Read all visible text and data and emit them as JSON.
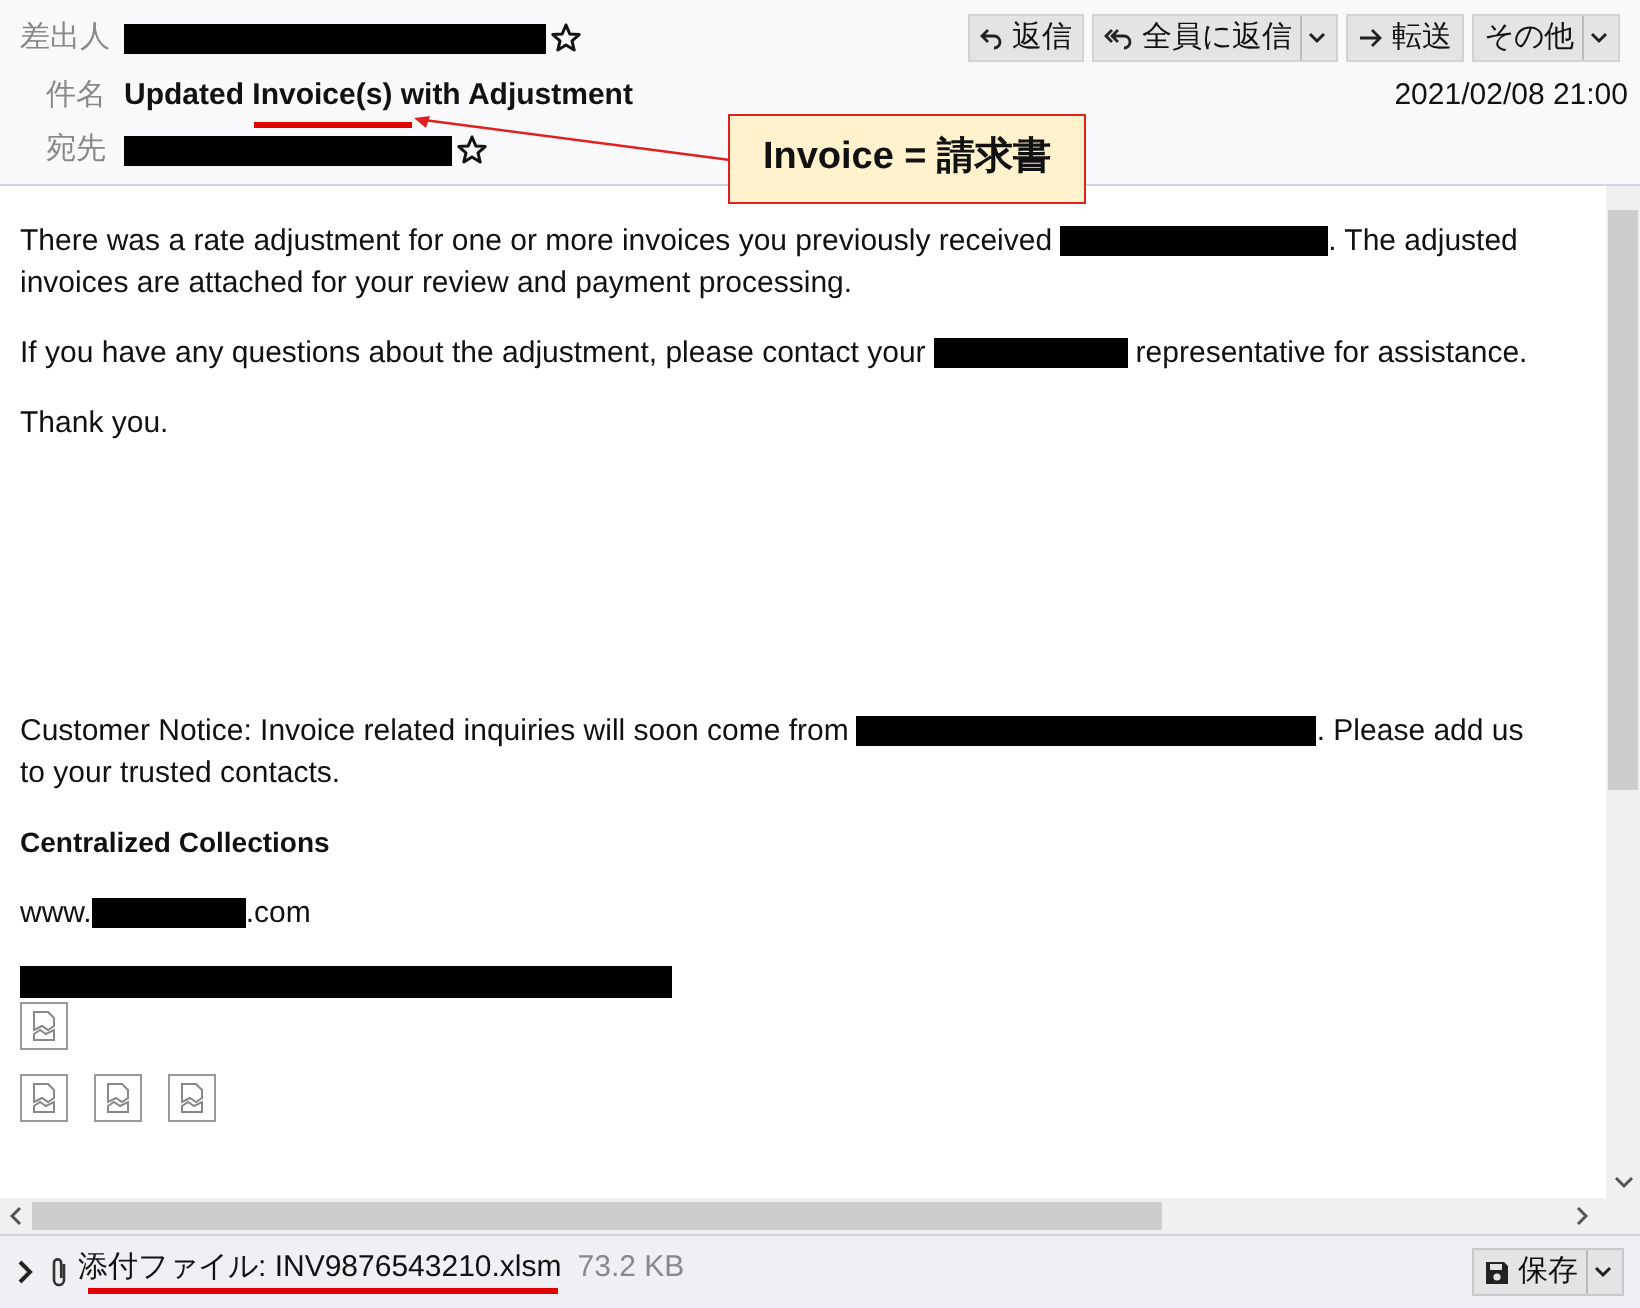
{
  "header": {
    "from_label": "差出人",
    "subject_label": "件名",
    "subject": "Updated Invoice(s) with Adjustment",
    "to_label": "宛先",
    "date": "2021/02/08 21:00",
    "buttons": [
      {
        "label": "返信",
        "dropdown": false
      },
      {
        "label": "全員に返信",
        "dropdown": true
      },
      {
        "label": "転送",
        "dropdown": false
      },
      {
        "label": "その他",
        "dropdown": true
      }
    ]
  },
  "annotation": {
    "text": "Invoice = 請求書"
  },
  "body": [
    {
      "kind": "paragraph",
      "lines": [
        [
          {
            "kind": "text",
            "text": "There was a rate adjustment for one or more invoices you previously received"
          },
          {
            "kind": "redacted"
          },
          {
            "kind": "text",
            "text": ". The adjusted"
          }
        ],
        [
          {
            "kind": "text",
            "text": "invoices are attached for your review and payment processing."
          }
        ]
      ]
    },
    {
      "kind": "paragraph",
      "lines": [
        [
          {
            "kind": "text",
            "text": "If you have any questions about the adjustment, please contact your"
          },
          {
            "kind": "redacted"
          },
          {
            "kind": "text",
            "text": "representative for assistance."
          }
        ]
      ]
    },
    {
      "kind": "paragraph",
      "lines": [
        [
          {
            "kind": "text",
            "text": "Thank you."
          }
        ]
      ]
    },
    {
      "kind": "spacer"
    },
    {
      "kind": "paragraph",
      "lines": [
        [
          {
            "kind": "text",
            "text": "Customer Notice: Invoice related inquiries will soon come from"
          },
          {
            "kind": "redacted"
          },
          {
            "kind": "text",
            "text": ". Please add us"
          }
        ],
        [
          {
            "kind": "text",
            "text": "to your trusted contacts."
          }
        ]
      ]
    },
    {
      "kind": "heading",
      "text": "Centralized Collections"
    },
    {
      "kind": "paragraph",
      "lines": [
        [
          {
            "kind": "text",
            "text": "www."
          },
          {
            "kind": "redacted"
          },
          {
            "kind": "text",
            "text": ".com"
          }
        ]
      ]
    },
    {
      "kind": "redacted-line"
    },
    {
      "kind": "images",
      "items": [
        {
          "kind": "broken-image"
        }
      ]
    },
    {
      "kind": "images",
      "items": [
        {
          "kind": "broken-image"
        },
        {
          "kind": "broken-image"
        },
        {
          "kind": "broken-image"
        }
      ]
    }
  ],
  "attachment": {
    "label": "添付ファイル: INV9876543210.xlsm",
    "size": "73.2 KB",
    "save": "保存"
  }
}
